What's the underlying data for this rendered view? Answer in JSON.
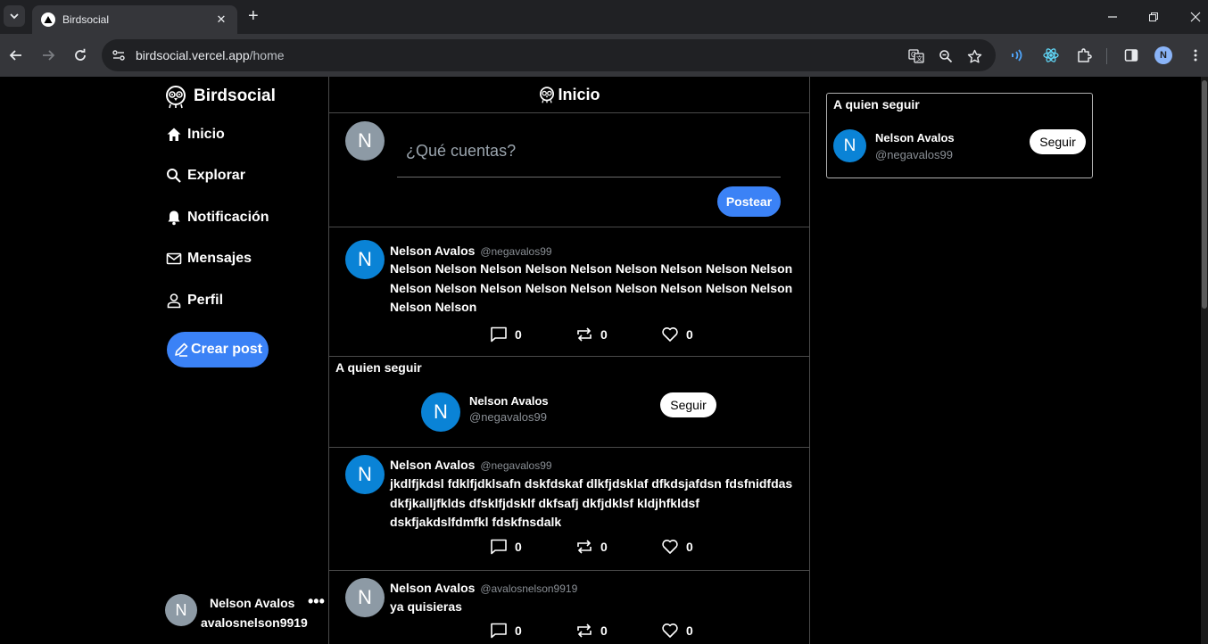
{
  "browser": {
    "tab_title": "Birdsocial",
    "url_host": "birdsocial.vercel.app",
    "url_path": "/home",
    "profile_initial": "N"
  },
  "sidebar": {
    "brand": "Birdsocial",
    "nav": {
      "home": "Inicio",
      "explore": "Explorar",
      "notifications": "Notificación",
      "messages": "Mensajes",
      "profile": "Perfil"
    },
    "create_post": "Crear post",
    "me": {
      "initial": "N",
      "name": "Nelson Avalos",
      "handle": "avalosnelson9919",
      "more": "•••"
    }
  },
  "feed": {
    "header_title": "Inicio",
    "composer": {
      "initial": "N",
      "placeholder": "¿Qué cuentas?",
      "submit": "Postear"
    },
    "posts": [
      {
        "initial": "N",
        "avatar_color": "#0a83d6",
        "name": "Nelson Avalos",
        "handle": "@negavalos99",
        "text": "Nelson Nelson Nelson Nelson Nelson Nelson Nelson Nelson Nelson Nelson Nelson Nelson Nelson Nelson Nelson Nelson Nelson Nelson Nelson Nelson",
        "comments": "0",
        "reposts": "0",
        "likes": "0"
      },
      {
        "initial": "N",
        "avatar_color": "#0a83d6",
        "name": "Nelson Avalos",
        "handle": "@negavalos99",
        "text": "jkdlfjkdsl fdklfjdklsafn dskfdskaf dlkfjdsklaf dfkdsjafdsn fdsfnidfdas dkfjkalljfklds dfsklfjdsklf dkfsafj dkfjdklsf kldjhfkldsf dskfjakdslfdmfkl fdskfnsdalk",
        "comments": "0",
        "reposts": "0",
        "likes": "0"
      },
      {
        "initial": "N",
        "avatar_color": "#8d9aa5",
        "name": "Nelson Avalos",
        "handle": "@avalosnelson9919",
        "text": "ya quisieras",
        "comments": "0",
        "reposts": "0",
        "likes": "0"
      }
    ],
    "who_to_follow": {
      "title": "A quien seguir",
      "initial": "N",
      "name": "Nelson Avalos",
      "handle": "@negavalos99",
      "button": "Seguir"
    }
  },
  "right": {
    "who_to_follow": {
      "title": "A quien seguir",
      "initial": "N",
      "name": "Nelson Avalos",
      "handle": "@negavalos99",
      "button": "Seguir"
    }
  },
  "colors": {
    "accent": "#3b82f6",
    "avatar_blue": "#0a83d6",
    "avatar_gray": "#8d9aa5",
    "background": "#000000",
    "border": "#4a4a4a"
  }
}
